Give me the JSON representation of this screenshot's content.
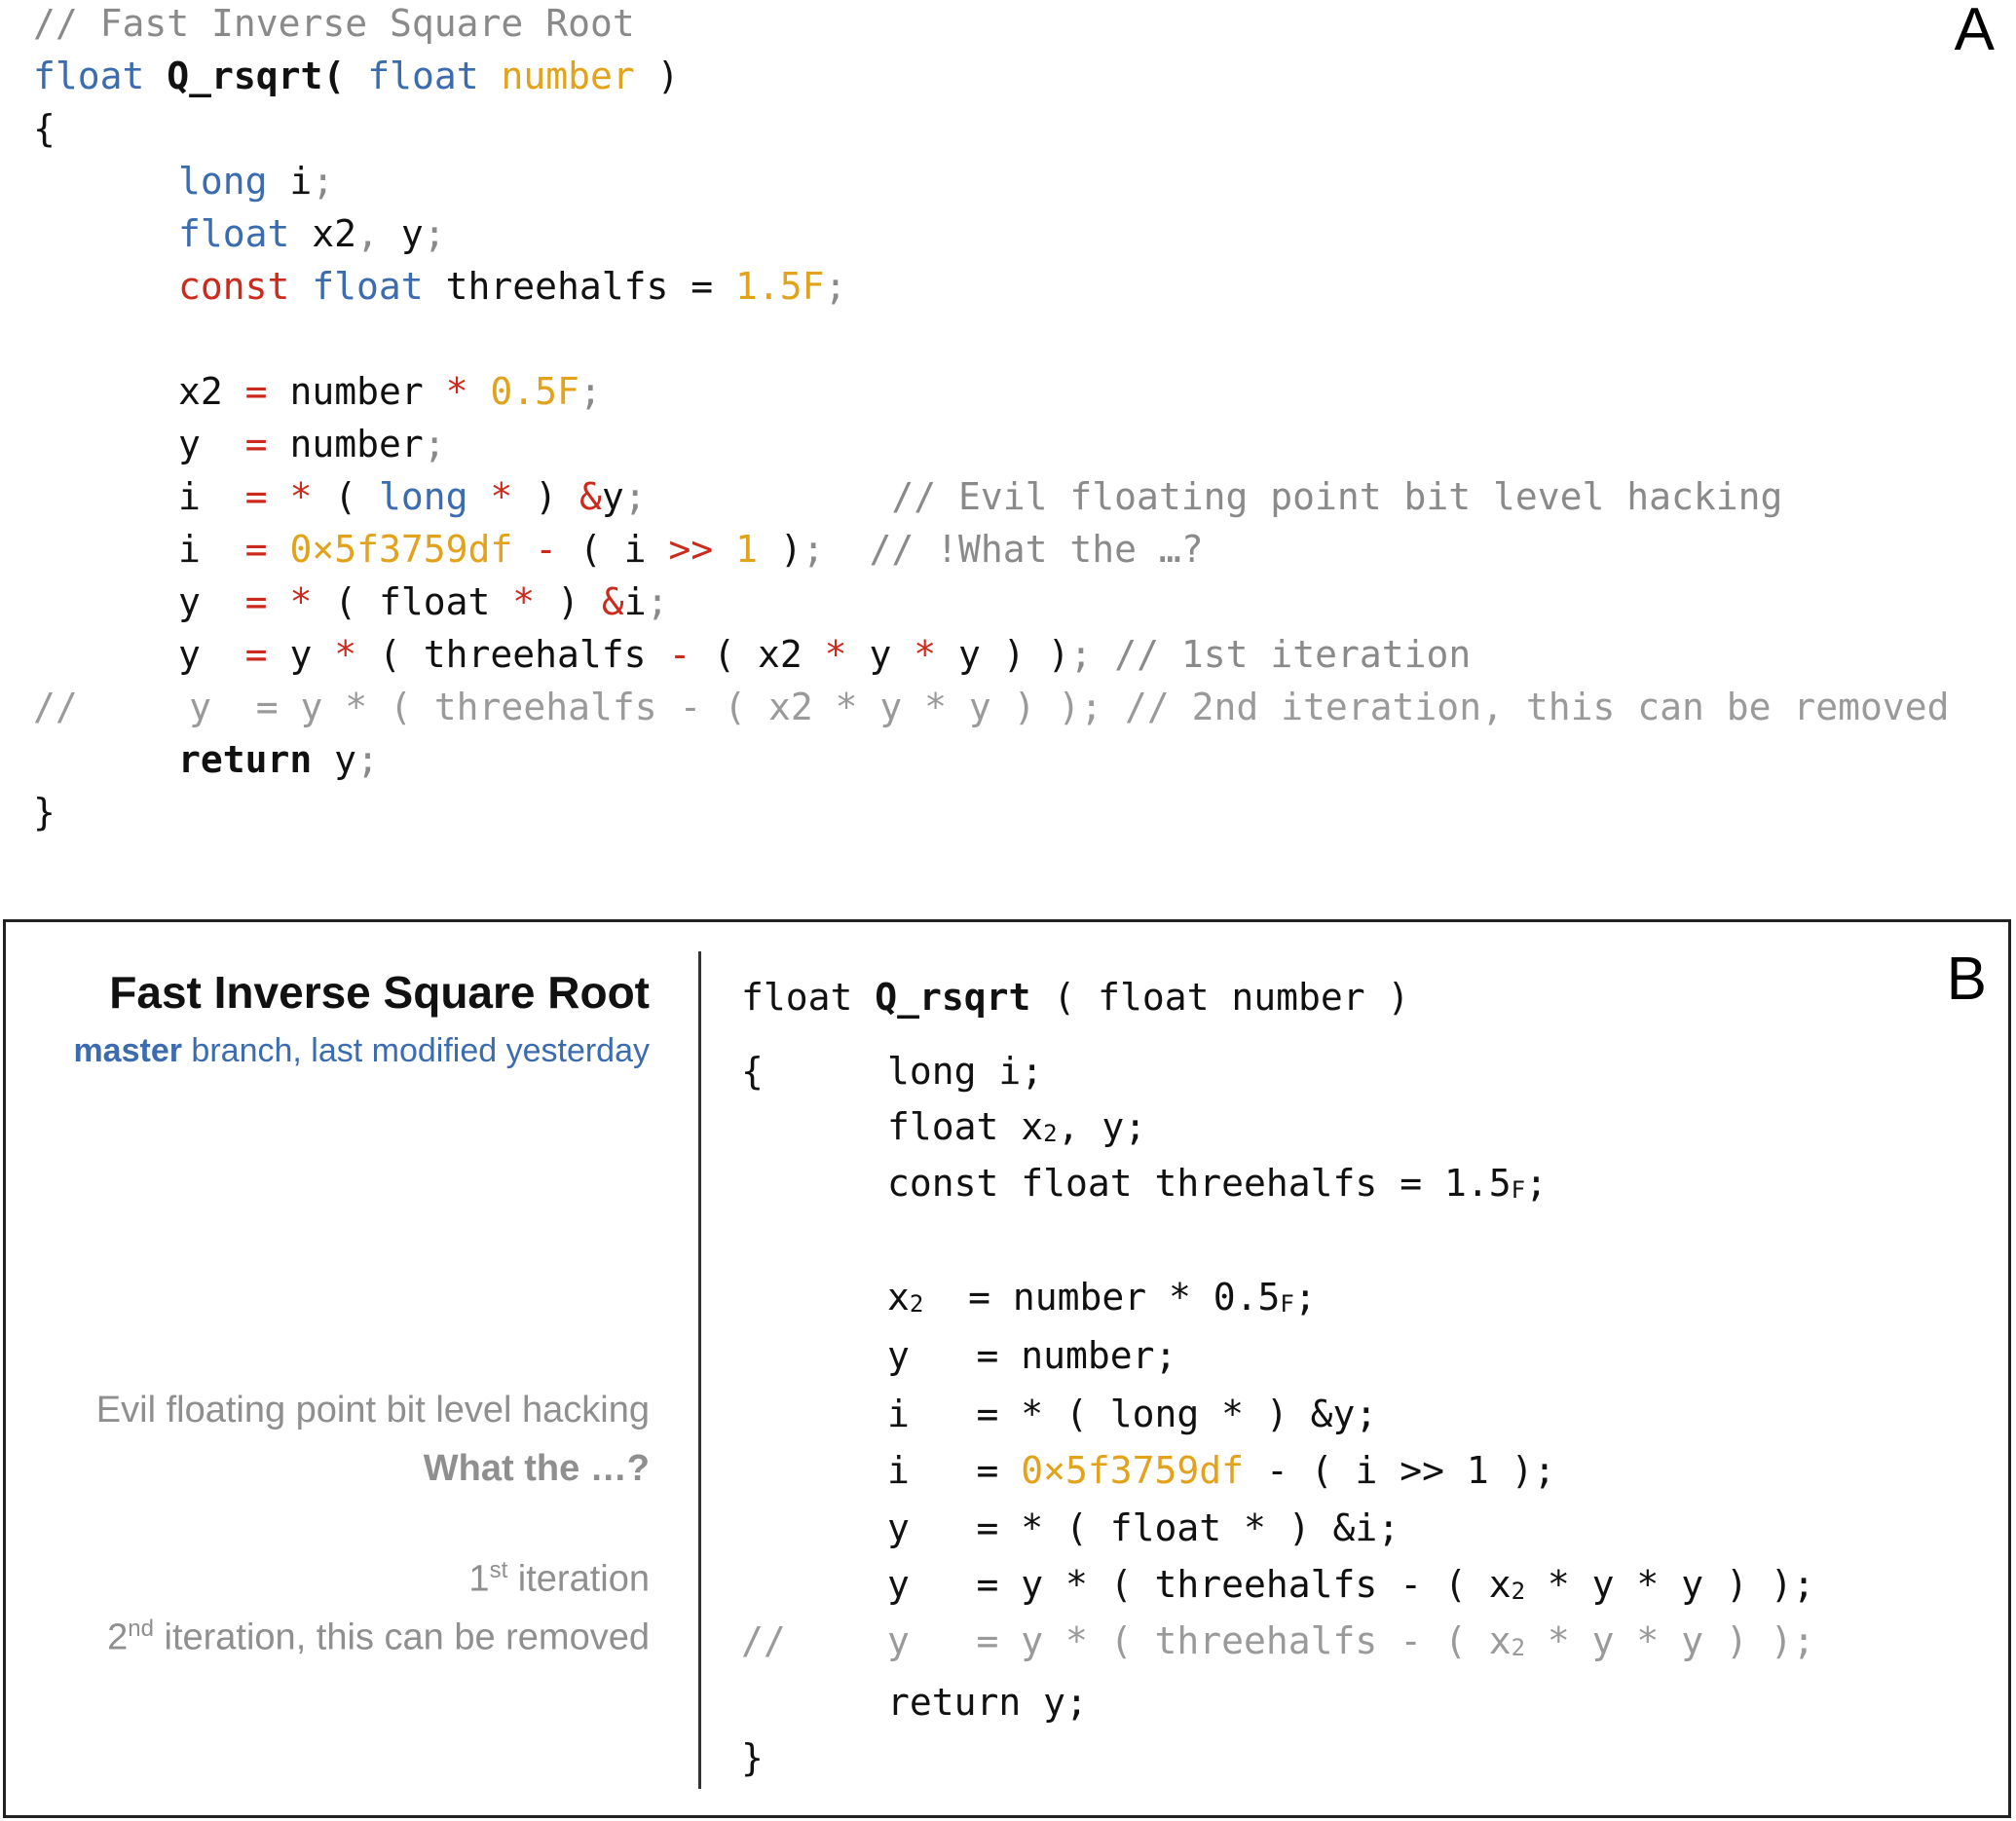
{
  "panel_a": {
    "letter": "A",
    "title_comment": "// Fast Inverse Square Root",
    "signature": {
      "t1": "float",
      "fn": "Q_rsqrt(",
      "t2": "float",
      "param": "number",
      "close": ")"
    },
    "brace_open": "{",
    "decl": {
      "long": "long",
      "i": "i",
      "semi": ";",
      "float": "float",
      "x2y": "x2",
      "comma": ",",
      "y": "y",
      "const": "const",
      "float2": "float",
      "threehalfs": "threehalfs",
      "eq": "=",
      "val": "1.5F"
    },
    "stmt": {
      "x2": "x2",
      "eq": "=",
      "number": "number",
      "mul": "*",
      "half": "0.5F",
      "y": "y",
      "i": "i",
      "long": "long",
      "amp_y": "&y",
      "open": "(",
      "close": ")",
      "magic": "0×5f3759df",
      "minus": "-",
      "shift": ">>",
      "one": "1",
      "float": "float",
      "amp_i": "&i",
      "threehalfs": "threehalfs",
      "return": "return"
    },
    "comments": {
      "hack": "// Evil floating point bit level hacking",
      "what": "// !What the …?",
      "iter1": "// 1st iteration",
      "iter2_line": "//     y  = y * ( threehalfs - ( x2 * y * y ) ); // 2nd iteration, this can be removed"
    },
    "brace_close": "}"
  },
  "panel_b": {
    "letter": "B",
    "title": "Fast Inverse Square Root",
    "branch": "master",
    "branch_rest": "branch, last modified yesterday",
    "notes": {
      "hack": "Evil floating point bit level hacking",
      "what": "What the …?",
      "iter1_num": "1",
      "iter1_sup": "st",
      "iter1_rest": "iteration",
      "iter2_num": "2",
      "iter2_sup": "nd",
      "iter2_rest": "iteration, this can be removed"
    },
    "code": {
      "sig_t1": "float",
      "sig_fn": "Q_rsqrt",
      "sig_rest": "( float number )",
      "brace_open": "{",
      "l1": "long i;",
      "l2a": "float x",
      "l2sub": "2",
      "l2b": ", y;",
      "l3a": "const float threehalfs = 1.5",
      "l3sub": "F",
      "l3b": ";",
      "l4a": "x",
      "l4sub": "2",
      "l4b": "  = number * 0.5",
      "l4sub2": "F",
      "l4c": ";",
      "l5": "y   = number;",
      "l6": "i   = * ( long * ) &y;",
      "l7a": "i   = ",
      "l7magic": "0×5f3759df",
      "l7b": " - ( i >> 1 );",
      "l8": "y   = * ( float * ) &i;",
      "l9a": "y   = y * ( threehalfs - ( x",
      "l9sub": "2",
      "l9b": " * y * y ) );",
      "l10slash": "//",
      "l10a": "y   = y * ( threehalfs - ( x",
      "l10sub": "2",
      "l10b": " * y * y ) );",
      "l11": "return y;",
      "brace_close": "}"
    }
  },
  "colors": {
    "keyword": "#3b6cb0",
    "operator": "#cc2a1c",
    "number": "#e2a21c",
    "comment": "#8a8a8a"
  }
}
